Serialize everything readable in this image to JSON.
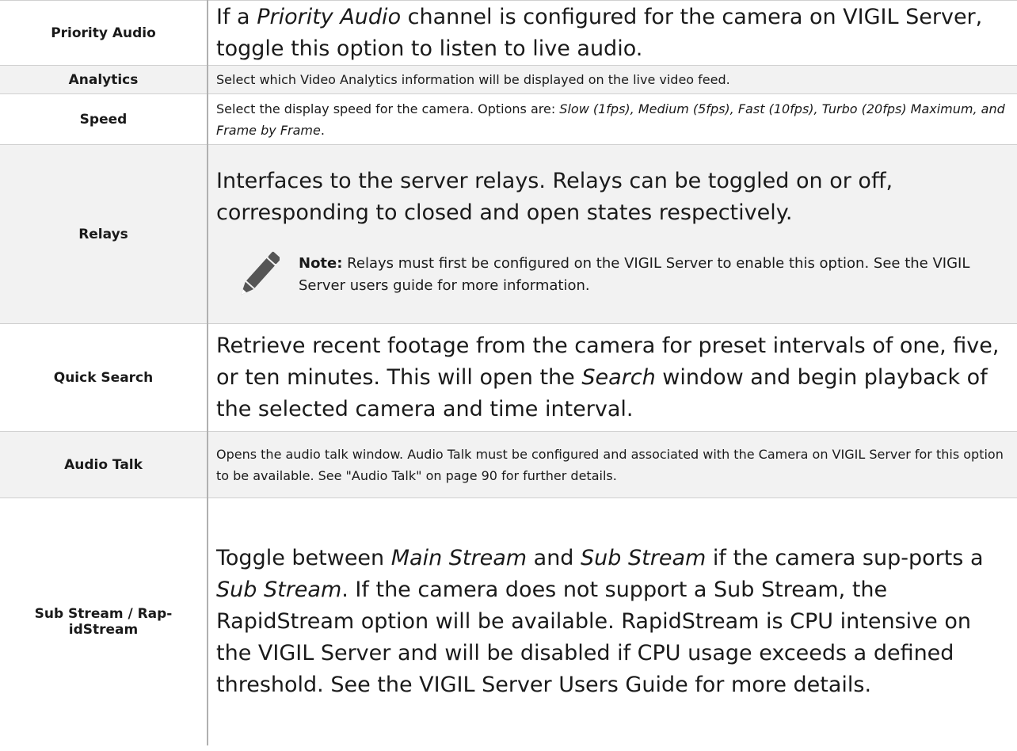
{
  "rows": [
    {
      "term": "Priority Audio",
      "desc_pre": "If a ",
      "desc_em": "Priority Audio",
      "desc_post": " channel is configured for the camera on VIGIL Server, toggle this option to listen to live audio."
    },
    {
      "term": "Analytics",
      "desc": "Select which Video Analytics information will be displayed on the live video feed."
    },
    {
      "term": "Speed",
      "desc_pre": "Select the display speed for the camera.  Options are: ",
      "desc_em": "Slow (1fps), Medium (5fps), Fast (10fps), Turbo (20fps) Maximum, and Frame by Frame",
      "desc_post": "."
    },
    {
      "term": "Relays",
      "desc": "Interfaces to the server relays.  Relays can be toggled on or off, corresponding to closed and open states respectively.",
      "note_label": "Note:",
      "note_text": " Relays must first be configured on the VIGIL Server to enable this option. See the VIGIL Server users guide for more information.",
      "note_icon": "pencil-icon"
    },
    {
      "term": "Quick Search",
      "desc_pre": "Retrieve recent footage from the camera for preset intervals of one, five, or ten minutes.  This will open the ",
      "desc_em": "Search",
      "desc_post": " window and begin playback of the selected camera and time interval."
    },
    {
      "term": "Audio Talk",
      "desc": "Opens the audio talk window.  Audio Talk must be configured and associated with the Camera on VIGIL Server for this option to be available. See \"Audio Talk\" on page 90 for further details."
    },
    {
      "term": "Sub Stream / Rap-idStream",
      "desc_1": "Toggle between ",
      "desc_em_1": "Main Stream",
      "desc_2": " and ",
      "desc_em_2": "Sub Stream",
      "desc_3": " if the camera sup-ports a ",
      "desc_em_3": "Sub Stream",
      "desc_4": ".  If the camera does not support a Sub Stream, the RapidStream option will be available.  RapidStream is CPU intensive on the VIGIL Server and will be disabled if CPU usage exceeds a defined threshold.  See the VIGIL Server Users Guide for more details."
    }
  ]
}
